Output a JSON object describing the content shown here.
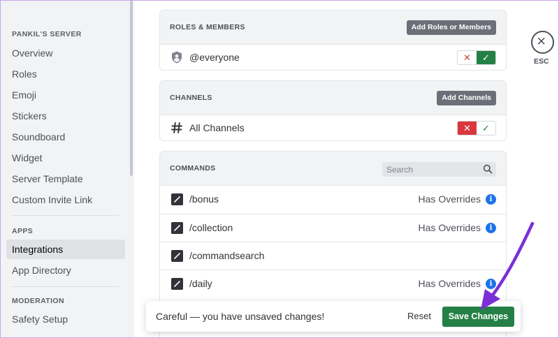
{
  "sidebar": {
    "server_header": "PANKIL'S SERVER",
    "server_items": [
      {
        "label": "Overview"
      },
      {
        "label": "Roles"
      },
      {
        "label": "Emoji"
      },
      {
        "label": "Stickers"
      },
      {
        "label": "Soundboard"
      },
      {
        "label": "Widget"
      },
      {
        "label": "Server Template"
      },
      {
        "label": "Custom Invite Link"
      }
    ],
    "apps_header": "APPS",
    "apps_items": [
      {
        "label": "Integrations",
        "active": true
      },
      {
        "label": "App Directory"
      }
    ],
    "moderation_header": "MODERATION",
    "moderation_items": [
      {
        "label": "Safety Setup"
      }
    ]
  },
  "roles_card": {
    "title": "ROLES & MEMBERS",
    "button": "Add Roles or Members",
    "rows": [
      {
        "label": "@everyone",
        "icon": "shield-user-icon",
        "state": "allowed"
      }
    ]
  },
  "channels_card": {
    "title": "CHANNELS",
    "button": "Add Channels",
    "rows": [
      {
        "label": "All Channels",
        "icon": "hash-icon",
        "state": "denied"
      }
    ]
  },
  "commands_card": {
    "title": "COMMANDS",
    "search_placeholder": "Search",
    "commands": [
      {
        "name": "/bonus",
        "overrides": "Has Overrides"
      },
      {
        "name": "/collection",
        "overrides": "Has Overrides"
      },
      {
        "name": "/commandsearch",
        "overrides": ""
      },
      {
        "name": "/daily",
        "overrides": "Has Overrides"
      }
    ]
  },
  "close": {
    "label": "ESC"
  },
  "notice": {
    "message": "Careful — you have unsaved changes!",
    "reset_label": "Reset",
    "save_label": "Save Changes"
  },
  "toggle_glyphs": {
    "deny": "✕",
    "allow": "✓"
  },
  "info_glyph": "i",
  "colors": {
    "accent_green": "#248046",
    "danger_red": "#da373c",
    "annotation_arrow": "#7b2fd6"
  }
}
